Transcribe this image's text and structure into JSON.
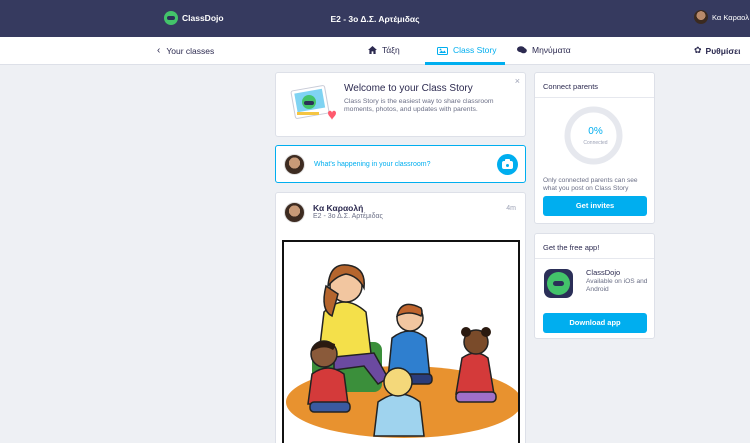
{
  "topbar": {
    "brand": "ClassDojo",
    "class_title": "E2 - 3ο Δ.Σ. Αρτέμιδας",
    "user_name": "Κα Καραολ"
  },
  "nav": {
    "back_label": "Your classes",
    "tabs": [
      {
        "label": "Τάξη",
        "icon": "home-icon"
      },
      {
        "label": "Class Story",
        "icon": "story-icon",
        "active": true
      },
      {
        "label": "Μηνύματα",
        "icon": "chat-icon"
      }
    ],
    "settings_label": "Ρυθμίσει"
  },
  "welcome": {
    "title": "Welcome to your Class Story",
    "description": "Class Story is the easiest way to share classroom moments, photos, and updates with parents.",
    "close": "×"
  },
  "composer": {
    "placeholder": "What's happening in your classroom?"
  },
  "post": {
    "author": "Κα Καραολή",
    "class_name": "E2 - 3ο Δ.Σ. Αρτέμιδας",
    "time": "4m"
  },
  "connect": {
    "title": "Connect parents",
    "percent": "0%",
    "percent_label": "Connected",
    "note": "Only connected parents can see what you post on Class Story",
    "button": "Get invites"
  },
  "app": {
    "title": "Get the free app!",
    "name": "ClassDojo",
    "description": "Available on iOS and Android",
    "button": "Download app"
  },
  "colors": {
    "topbar": "#363a5f",
    "accent": "#00aeef",
    "brand_green": "#43c36a",
    "background": "#eef0f4"
  }
}
